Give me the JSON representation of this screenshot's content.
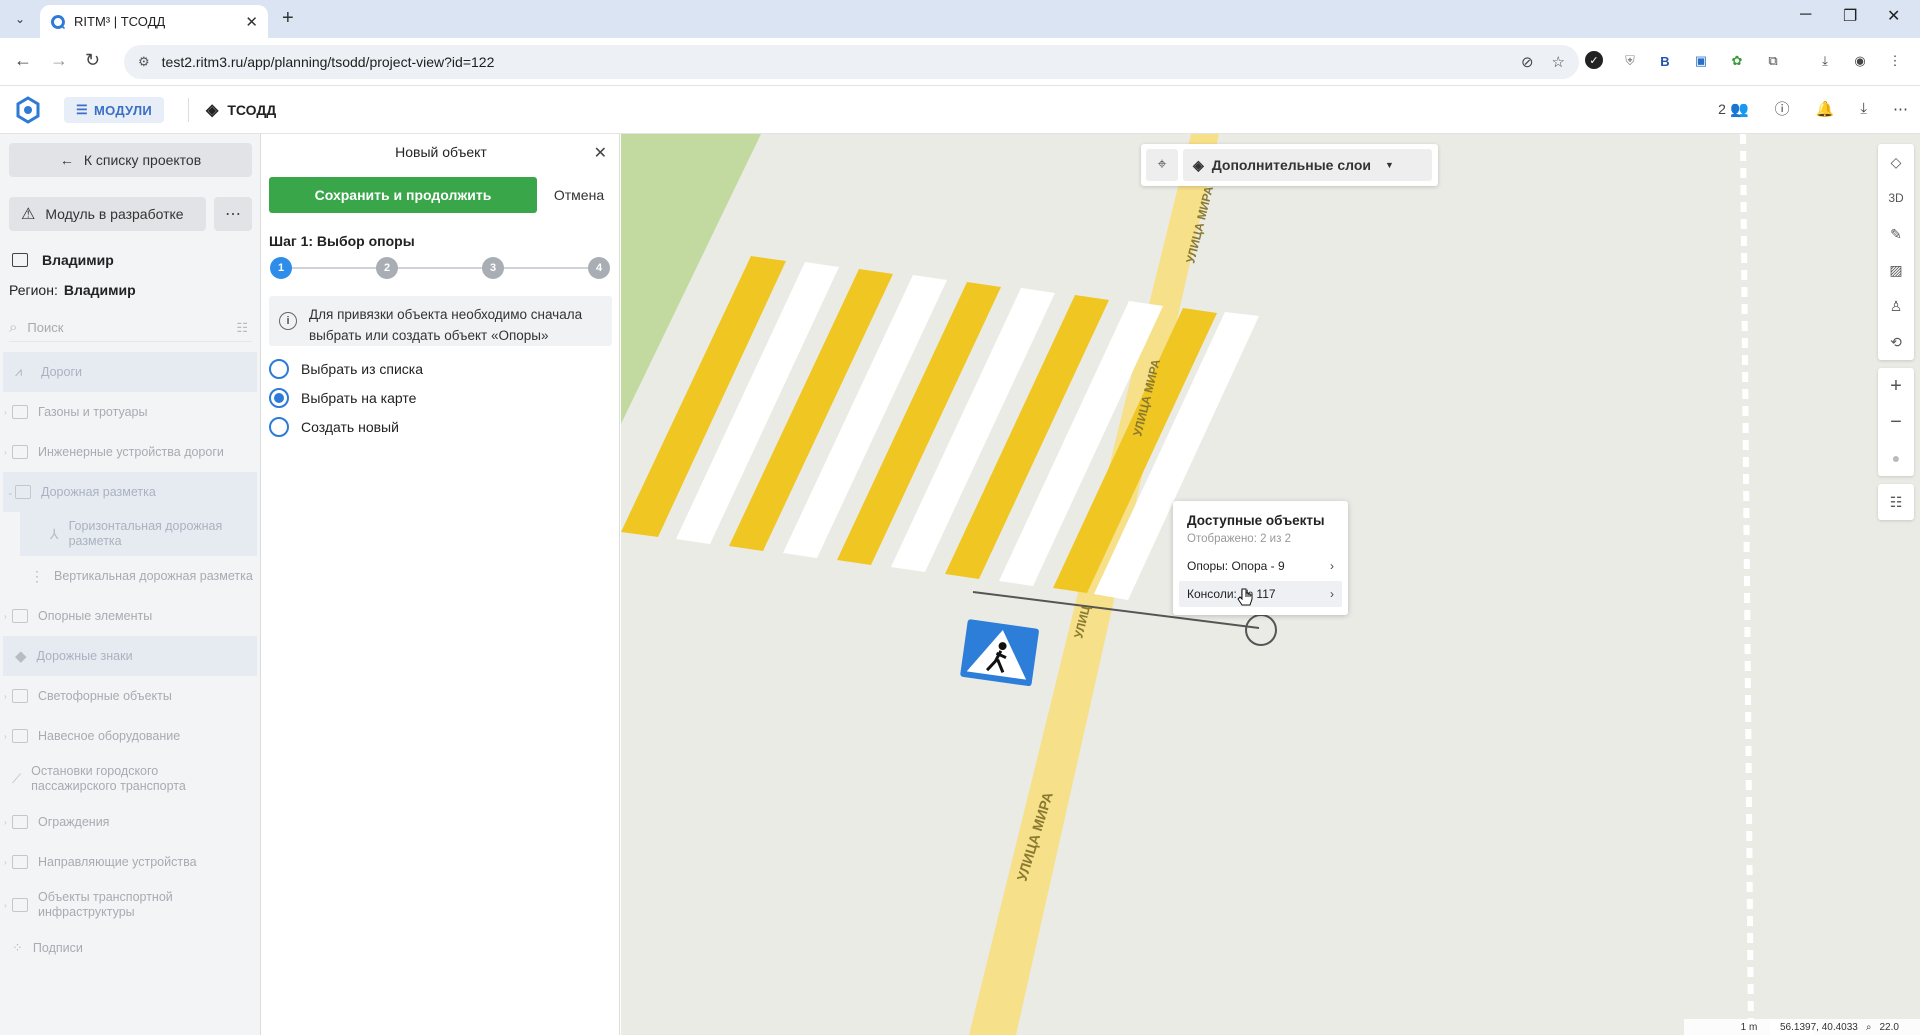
{
  "browser": {
    "tab_title": "RITM³ | ТСОДД",
    "url": "test2.ritm3.ru/app/planning/tsodd/project-view?id=122"
  },
  "header": {
    "modules_label": "МОДУЛИ",
    "section_title": "ТСОДД",
    "users_count": "2"
  },
  "sidebar": {
    "back_label": "К списку проектов",
    "dev_label": "Модуль в разработке",
    "project_name": "Владимир",
    "region_label": "Регион:",
    "region_value": "Владимир",
    "search_placeholder": "Поиск",
    "tree": [
      {
        "label": "Дороги"
      },
      {
        "label": "Газоны и тротуары"
      },
      {
        "label": "Инженерные устройства дороги"
      },
      {
        "label": "Дорожная разметка"
      },
      {
        "label": "Горизонтальная дорожная разметка"
      },
      {
        "label": "Вертикальная дорожная разметка"
      },
      {
        "label": "Опорные элементы"
      },
      {
        "label": "Дорожные знаки"
      },
      {
        "label": "Светофорные объекты"
      },
      {
        "label": "Навесное оборудование"
      },
      {
        "label": "Остановки городского пассажирского транспорта"
      },
      {
        "label": "Ограждения"
      },
      {
        "label": "Направляющие устройства"
      },
      {
        "label": "Объекты транспортной инфраструктуры"
      },
      {
        "label": "Подписи"
      }
    ]
  },
  "form": {
    "title": "Новый объект",
    "save_label": "Сохранить и продолжить",
    "cancel_label": "Отмена",
    "step_label": "Шаг 1: Выбор опоры",
    "steps": [
      "1",
      "2",
      "3",
      "4"
    ],
    "active_step": 1,
    "info_text": "Для привязки объекта необходимо сначала выбрать или создать объект «Опоры»",
    "options": [
      {
        "label": "Выбрать из списка",
        "selected": false
      },
      {
        "label": "Выбрать на карте",
        "selected": true
      },
      {
        "label": "Создать новый",
        "selected": false
      }
    ]
  },
  "map": {
    "layers_label": "Дополнительные слои",
    "street_name": "УЛИЦА МИРА",
    "street_name_short": "УЛИЦ",
    "popup": {
      "title": "Доступные объекты",
      "subtitle": "Отображено: 2 из 2",
      "items": [
        "Опоры: Опора - 9",
        "Консоли: № 117"
      ]
    },
    "tools_3d": "3D",
    "scale": "1 m",
    "coords": "56.1397, 40.4033",
    "zoom": "22.0"
  },
  "colors": {
    "accent": "#2d8de8",
    "save_green": "#3aa64a",
    "marking_yellow": "#f0c623",
    "road": "#f7e08a"
  }
}
